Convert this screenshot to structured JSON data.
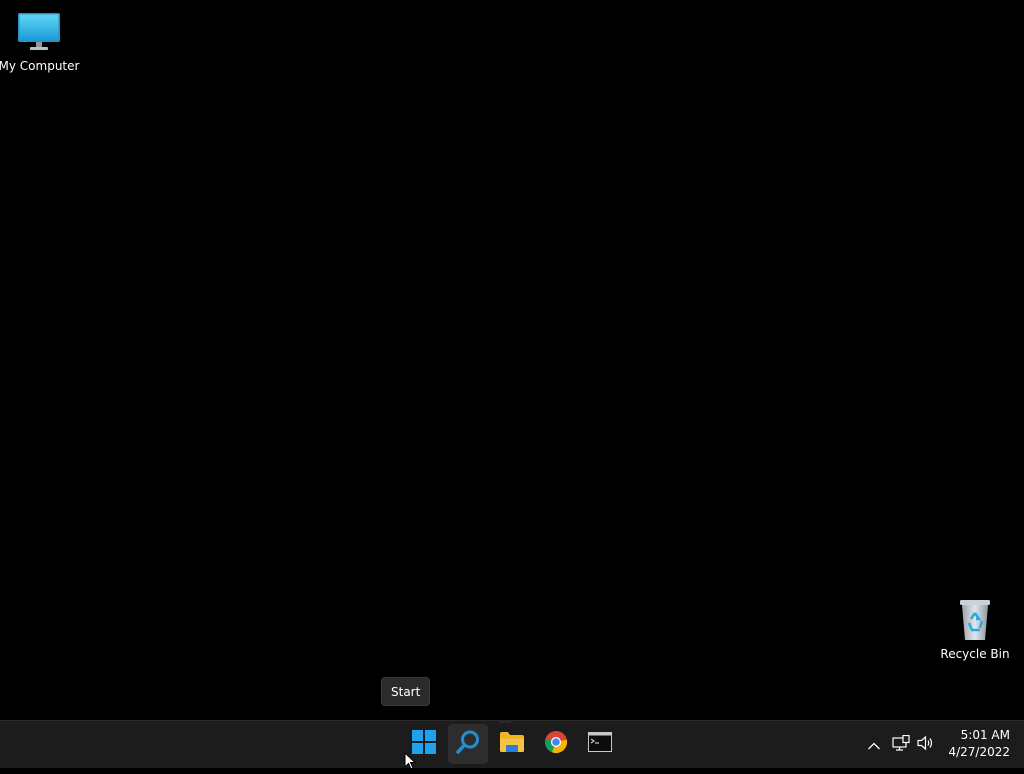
{
  "desktop": {
    "icons": [
      {
        "label": "My Computer",
        "icon": "monitor-icon"
      },
      {
        "label": "Recycle Bin",
        "icon": "recycle-bin-icon"
      }
    ],
    "background_color": "#000000"
  },
  "tooltip": {
    "text": "Start"
  },
  "taskbar": {
    "apps": [
      {
        "name": "start",
        "icon": "windows-logo-icon"
      },
      {
        "name": "search",
        "icon": "search-icon"
      },
      {
        "name": "file-explorer",
        "icon": "folder-icon"
      },
      {
        "name": "chrome",
        "icon": "chrome-icon"
      },
      {
        "name": "terminal",
        "icon": "terminal-icon"
      }
    ],
    "tray": {
      "chevron_icon": "chevron-up-icon",
      "network_icon": "network-icon",
      "volume_icon": "volume-icon"
    },
    "clock": {
      "time": "5:01 AM",
      "date": "4/27/2022"
    },
    "background_color": "#1c1c1c"
  },
  "colors": {
    "windows_blue": "#1fa3f0",
    "folder_yellow": "#f5c343"
  }
}
